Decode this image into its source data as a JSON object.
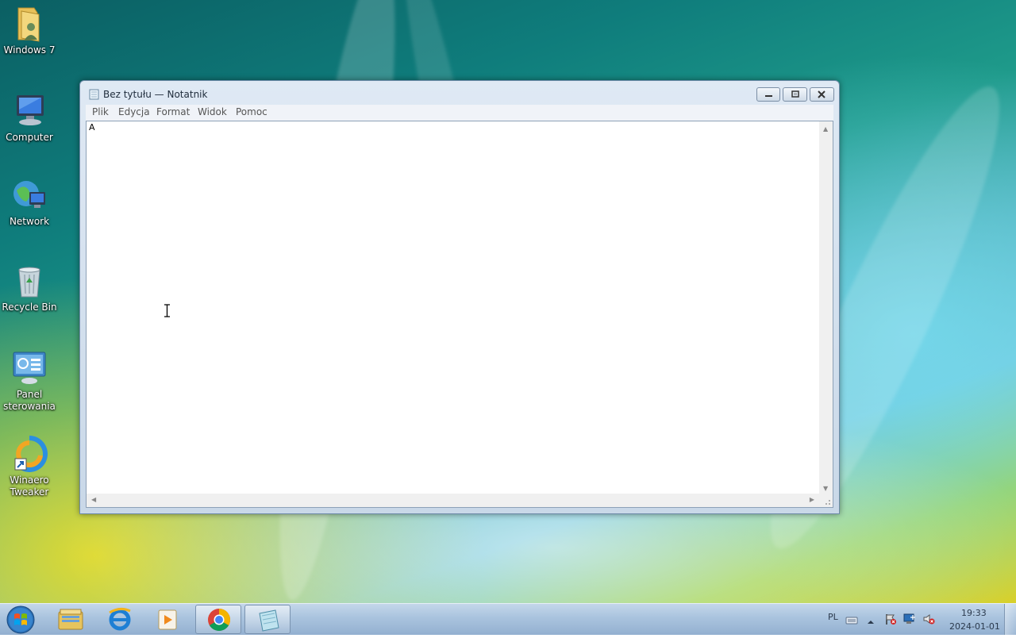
{
  "desktop": {
    "icons": [
      {
        "label": "Windows 7"
      },
      {
        "label": "Computer"
      },
      {
        "label": "Network"
      },
      {
        "label": "Recycle Bin"
      },
      {
        "label": "Panel sterowania"
      },
      {
        "label": "Winaero Tweaker"
      }
    ]
  },
  "window": {
    "title": "Bez tytułu — Notatnik",
    "menu": [
      "Plik",
      "Edycja",
      "Format",
      "Widok",
      "Pomoc"
    ],
    "content": "A"
  },
  "taskbar": {
    "pinned": [
      "windows-explorer-icon",
      "internet-explorer-icon",
      "media-player-icon",
      "chrome-icon",
      "notepad-icon"
    ],
    "tray": {
      "language": "PL",
      "time": "19:33",
      "date": "2024-01-01"
    }
  },
  "colors": {
    "taskbar": "#a9c3de",
    "window_frame": "#c9d8e8",
    "editor_bg": "#ffffff"
  }
}
